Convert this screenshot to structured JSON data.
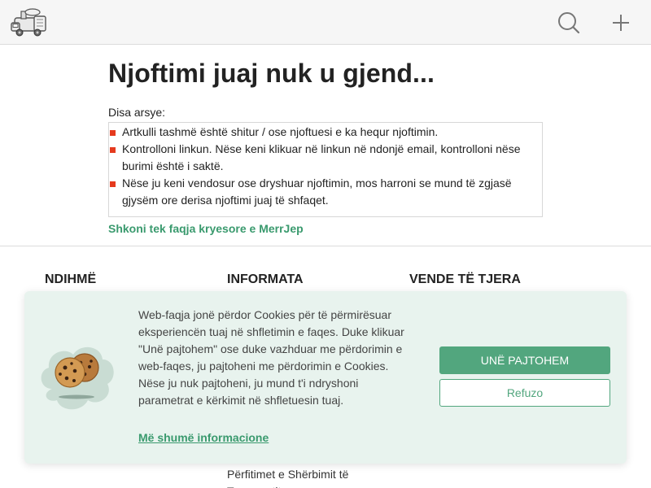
{
  "header": {
    "logo_icon": "merrjep-truck-logo-icon",
    "search_icon": "search-icon",
    "add_icon": "plus-icon"
  },
  "main": {
    "title": "Njoftimi juaj nuk u gjend...",
    "reasons_label": "Disa arsye:",
    "reasons": [
      "Artkulli tashmë është shitur / ose njoftuesi e ka hequr njoftimin.",
      "Kontrolloni linkun. Nëse keni klikuar në linkun në ndonjë email, kontrolloni nëse burimi është i saktë.",
      "Nëse ju keni vendosur ose dryshuar njoftimin, mos harroni se mund të zgjasë gjysëm ore derisa njoftimi juaj të shfaqet."
    ],
    "home_link": "Shkoni tek faqja kryesore e MerrJep"
  },
  "footer": {
    "columns": [
      {
        "title": "NDIHMË"
      },
      {
        "title": "INFORMATA",
        "visible_links": [
          "Përfitimet e Shërbimit të Transportit"
        ]
      },
      {
        "title": "VENDE TË TJERA"
      }
    ]
  },
  "cookie": {
    "icon": "cookie-icon",
    "text": "Web-faqja jonë përdor Cookies për të përmirësuar eksperiencën tuaj në shfletimin e faqes. Duke klikuar \"Unë pajtohem\" ose duke vazhduar me përdorimin e web-faqes, ju pajtoheni me përdorimin e Cookies. Nëse ju nuk pajtoheni, ju mund t'i ndryshoni parametrat e kërkimit në shfletuesin tuaj.",
    "more_info": "Më shumë informacione",
    "accept_label": "UNË PAJTOHEM",
    "refuse_label": "Refuzo"
  },
  "colors": {
    "accent_green": "#52a67e",
    "link_green": "#3a9a6e",
    "bullet_red": "#e53a1e",
    "cookie_bg": "#e8f3ee"
  }
}
